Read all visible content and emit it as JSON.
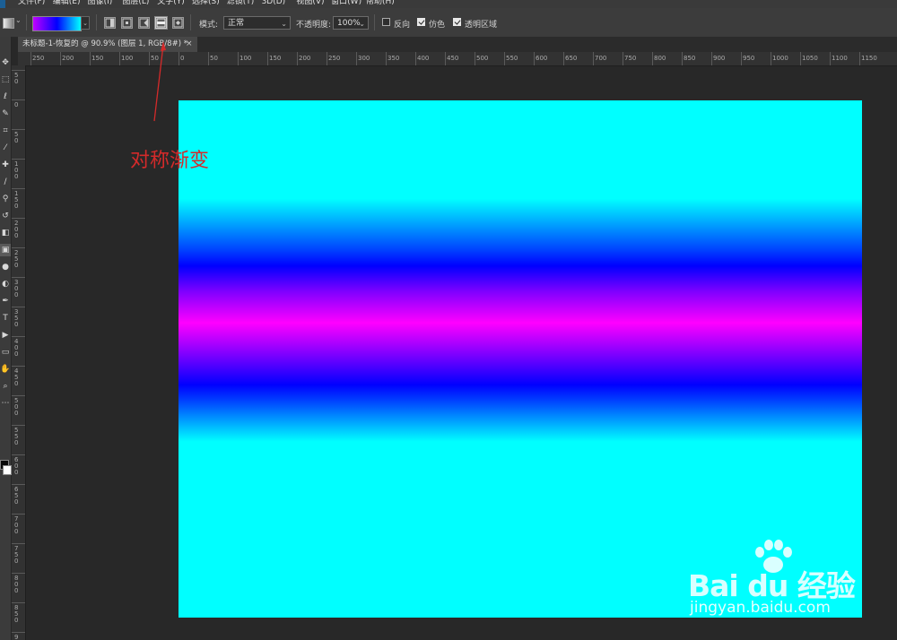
{
  "menu": {
    "items": [
      "文件(F)",
      "编辑(E)",
      "图像(I)",
      "图层(L)",
      "文字(Y)",
      "选择(S)",
      "滤镜(T)",
      "3D(D)",
      "视图(V)",
      "窗口(W)",
      "帮助(H)"
    ]
  },
  "options": {
    "mode_label": "模式:",
    "mode_value": "正常",
    "opacity_label": "不透明度:",
    "opacity_value": "100%",
    "reverse_label": "反向",
    "reverse_checked": false,
    "dither_label": "仿色",
    "dither_checked": true,
    "transparency_label": "透明区域",
    "transparency_checked": true,
    "gradient_types": [
      "linear",
      "radial",
      "angle",
      "reflected",
      "diamond"
    ],
    "active_gradient_type": "reflected",
    "gradient_preview_colors": [
      "#c000ff",
      "#0000ff",
      "#00ffff"
    ]
  },
  "document": {
    "tab_title": "未标题-1-恢复的 @ 90.9% (图层 1, RGB/8#) *",
    "tab_close": "×"
  },
  "ruler": {
    "h_labels": [
      "250",
      "200",
      "150",
      "100",
      "50",
      "0",
      "50",
      "100",
      "150",
      "200",
      "250",
      "300",
      "350",
      "400",
      "450",
      "500",
      "550",
      "600",
      "650",
      "700",
      "750",
      "800",
      "850",
      "900",
      "950",
      "1000",
      "1050",
      "1100",
      "1150"
    ],
    "v_labels": [
      "5 0",
      "0",
      "5 0",
      "1 0 0",
      "1 5 0",
      "2 0 0",
      "2 5 0",
      "3 0 0",
      "3 5 0",
      "4 0 0",
      "4 5 0",
      "5 0 0",
      "5 5 0",
      "6 0 0",
      "6 5 0",
      "7 0 0",
      "7 5 0",
      "8 0 0",
      "8 5 0",
      "9 0 0"
    ]
  },
  "tools": [
    "move",
    "marquee",
    "lasso",
    "quick-select",
    "crop",
    "eyedropper",
    "healing",
    "brush",
    "stamp",
    "history-brush",
    "eraser",
    "gradient",
    "blur",
    "dodge",
    "pen",
    "type",
    "path-select",
    "shape",
    "hand",
    "zoom",
    "more"
  ],
  "annotation": {
    "text": "对称渐变",
    "color": "#d42a2a"
  },
  "watermark": {
    "brand": "Bai du 经验",
    "url": "jingyan.baidu.com"
  },
  "canvas": {
    "gradient_colors": [
      "#00ffff",
      "#0000ff",
      "#ff00ff",
      "#0000ff",
      "#00ffff"
    ]
  }
}
